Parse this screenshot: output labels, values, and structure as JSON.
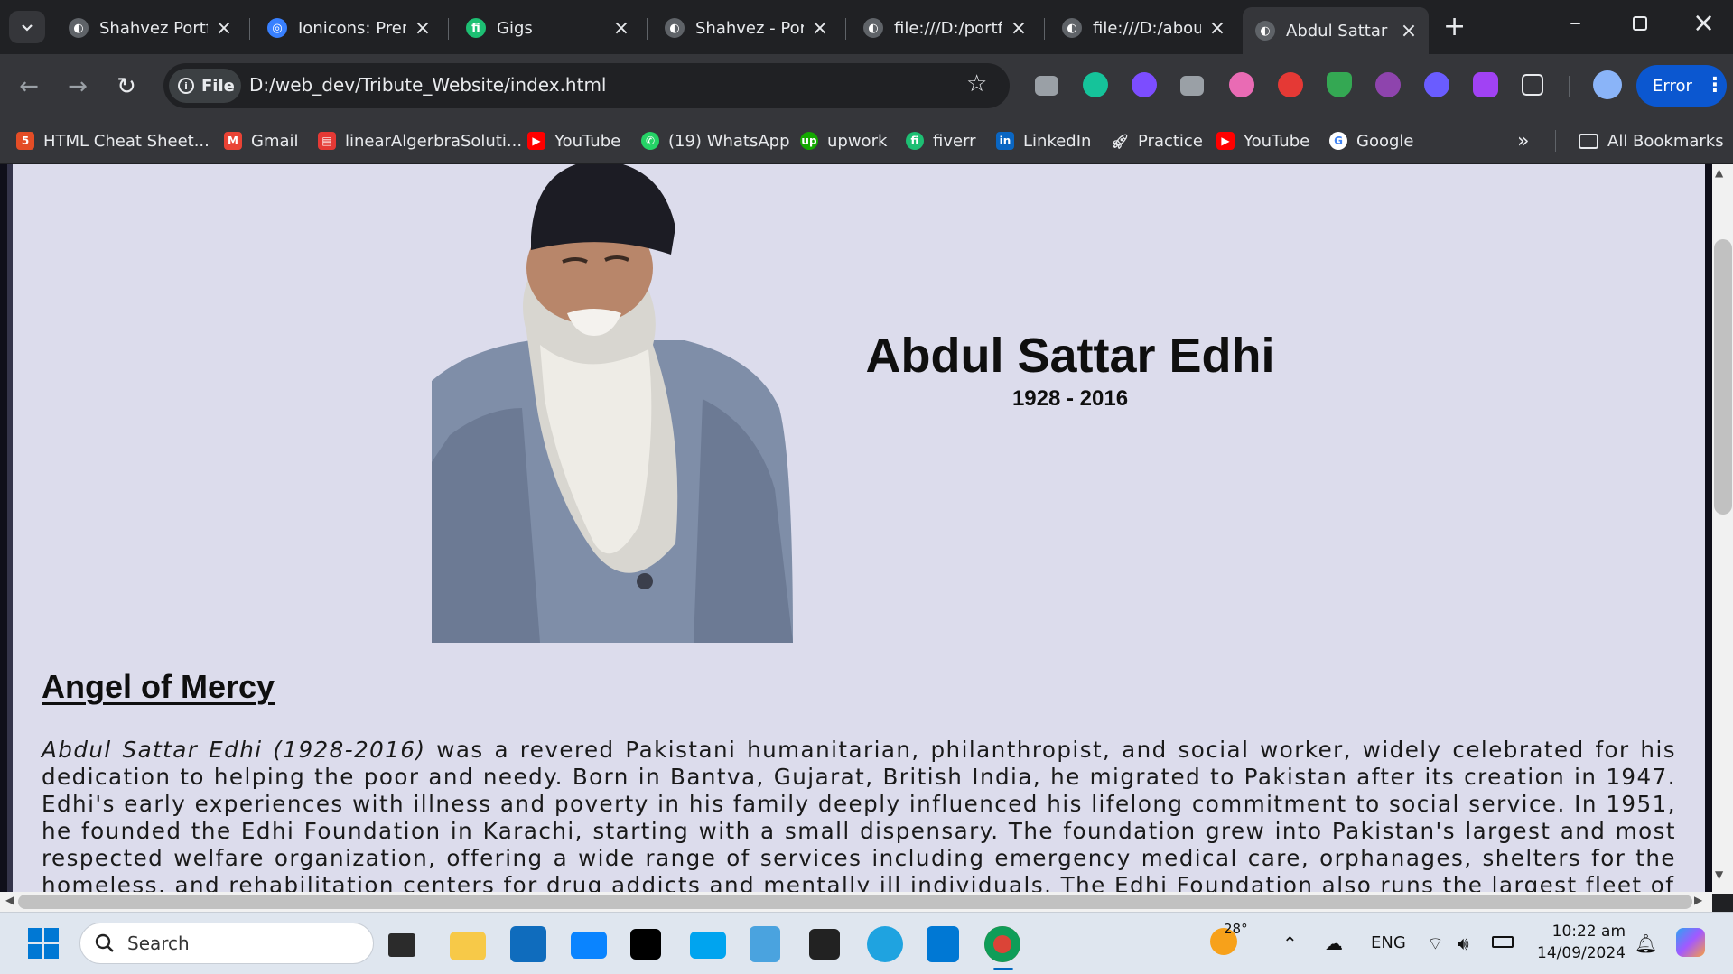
{
  "tabs": [
    {
      "title": "Shahvez Portfo",
      "icon": "globe-icon"
    },
    {
      "title": "Ionicons: Prem",
      "icon": "ionicons-icon"
    },
    {
      "title": "Gigs",
      "icon": "fiverr-icon"
    },
    {
      "title": "Shahvez - Port",
      "icon": "globe-icon"
    },
    {
      "title": "file:///D:/portf",
      "icon": "globe-icon"
    },
    {
      "title": "file:///D:/abou",
      "icon": "globe-icon"
    },
    {
      "title": "Abdul Sattar E",
      "icon": "globe-icon",
      "active": true
    }
  ],
  "toolbar": {
    "file_chip": "File",
    "url": "D:/web_dev/Tribute_Website/index.html",
    "error_label": "Error"
  },
  "bookmarks": [
    {
      "label": "HTML Cheat Sheet...",
      "color": "#e44d26"
    },
    {
      "label": "Gmail",
      "color": "#ea4335"
    },
    {
      "label": "linearAlgerbraSoluti...",
      "color": "#e53935"
    },
    {
      "label": "YouTube",
      "color": "#ff0000"
    },
    {
      "label": "(19) WhatsApp",
      "color": "#25d366"
    },
    {
      "label": "upwork",
      "color": "#14a800"
    },
    {
      "label": "fiverr",
      "color": "#1dbf73"
    },
    {
      "label": "LinkedIn",
      "color": "#0a66c2"
    },
    {
      "label": "Practice",
      "color": "#9aa0a6"
    },
    {
      "label": "YouTube",
      "color": "#ff0000"
    },
    {
      "label": "Google",
      "color": "#4285f4"
    }
  ],
  "all_bookmarks": "All Bookmarks",
  "page": {
    "name": "Abdul Sattar Edhi",
    "years": "1928 - 2016",
    "section_title": "Angel of Mercy",
    "bio_lead": "Abdul Sattar Edhi (1928-2016)",
    "bio_rest": " was a revered Pakistani humanitarian, philanthropist, and social worker, widely celebrated for his dedication to helping the poor and needy. Born in Bantva, Gujarat, British India, he migrated to Pakistan after its creation in 1947. Edhi's early experiences with illness and poverty in his family deeply influenced his lifelong commitment to social service. In 1951, he founded the Edhi Foundation in Karachi, starting with a small dispensary. The foundation grew into Pakistan's largest and most respected welfare organization, offering a wide range of services including emergency medical care, orphanages, shelters for the homeless, and rehabilitation centers for drug addicts and mentally ill individuals. The Edhi Foundation also runs the largest fleet of"
  },
  "taskbar": {
    "search_placeholder": "Search",
    "temperature": "28°",
    "language": "ENG",
    "time": "10:22 am",
    "date": "14/09/2024"
  }
}
